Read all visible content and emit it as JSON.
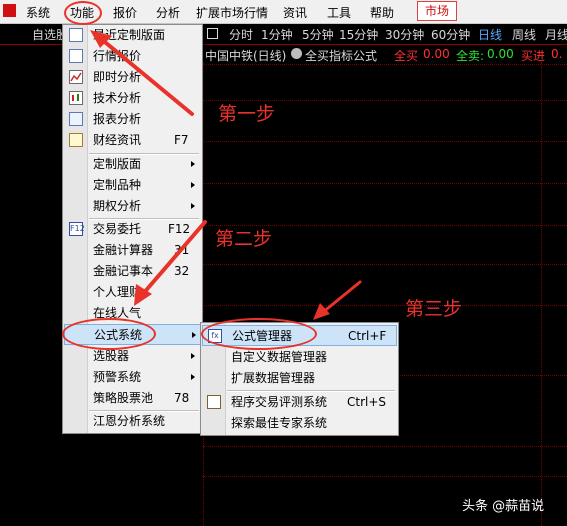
{
  "menubar": {
    "items": [
      "系统",
      "功能",
      "报价",
      "分析",
      "扩展市场行情",
      "资讯",
      "工具",
      "帮助"
    ],
    "market": "市场"
  },
  "toolbar": {
    "left_label": "自选股",
    "periods": [
      "分时",
      "1分钟",
      "5分钟",
      "15分钟",
      "30分钟",
      "60分钟",
      "日线",
      "周线",
      "月线"
    ],
    "selected_period": "日线"
  },
  "chart_info": {
    "title": "中国中铁(日线)",
    "formula": "全买指标公式",
    "all_buy_label": "全买",
    "all_buy_value": "0.00",
    "all_sell_label": "全卖:",
    "all_sell_value": "0.00",
    "buy_in_label": "买进",
    "buy_in_value": "0.",
    "color_red": "#ff3030",
    "color_green": "#30e030"
  },
  "function_menu": {
    "items": [
      {
        "label": "最近定制版面",
        "icon": "recent-layout-icon"
      },
      {
        "label": "行情报价",
        "icon": "quote-icon"
      },
      {
        "label": "即时分析",
        "icon": "realtime-chart-icon"
      },
      {
        "label": "技术分析",
        "icon": "candlestick-icon"
      },
      {
        "label": "报表分析",
        "icon": "report-icon"
      },
      {
        "label": "财经资讯",
        "shortcut": "F7",
        "icon": "news-icon"
      },
      {
        "label": "定制版面"
      },
      {
        "label": "定制品种"
      },
      {
        "label": "期权分析"
      },
      {
        "label": "交易委托",
        "shortcut": "F12",
        "icon": "f12-icon"
      },
      {
        "label": "金融计算器",
        "shortcut": "31"
      },
      {
        "label": "金融记事本",
        "shortcut": "32"
      },
      {
        "label": "个人理财"
      },
      {
        "label": "在线人气"
      },
      {
        "label": "公式系统"
      },
      {
        "label": "选股器"
      },
      {
        "label": "预警系统"
      },
      {
        "label": "策略股票池",
        "shortcut": "78"
      },
      {
        "label": "江恩分析系统"
      }
    ]
  },
  "formula_submenu": {
    "items": [
      {
        "label": "公式管理器",
        "shortcut": "Ctrl+F",
        "icon": "formula-manager-icon"
      },
      {
        "label": "自定义数据管理器"
      },
      {
        "label": "扩展数据管理器"
      },
      {
        "label": "程序交易评测系统",
        "shortcut": "Ctrl+S",
        "icon": "clipboard-icon"
      },
      {
        "label": "探索最佳专家系统"
      }
    ]
  },
  "annotations": {
    "step1": "第一步",
    "step2": "第二步",
    "step3": "第三步",
    "color": "#e8322a"
  },
  "watermark": "头条 @蒜苗说"
}
